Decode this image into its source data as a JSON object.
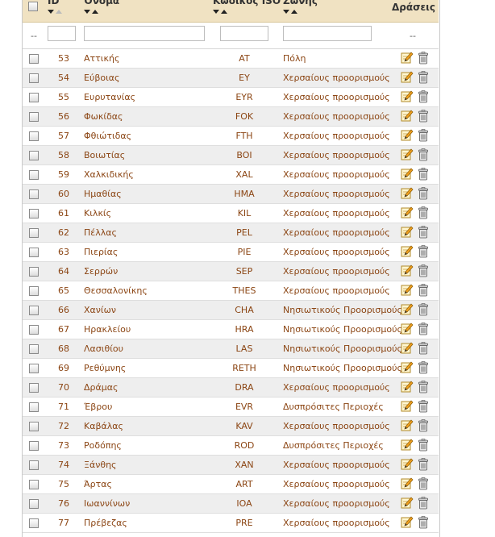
{
  "header": {
    "id_label": "ID",
    "name_label": "Όνομα",
    "iso_label": "Κωδικός ISO",
    "zone_label": "Ζώνης",
    "actions_label": "Δράσεις"
  },
  "filters": {
    "left_dash": "--",
    "right_dash": "--",
    "id_value": "",
    "name_value": "",
    "iso_value": "",
    "zone_value": ""
  },
  "rows": [
    {
      "id": "53",
      "name": "Αττικής",
      "iso": "AT",
      "zone": "Πόλη"
    },
    {
      "id": "54",
      "name": "Εύβοιας",
      "iso": "EY",
      "zone": "Χερσαίους προορισμούς"
    },
    {
      "id": "55",
      "name": "Ευρυτανίας",
      "iso": "EYR",
      "zone": "Χερσαίους προορισμούς"
    },
    {
      "id": "56",
      "name": "Φωκίδας",
      "iso": "FOK",
      "zone": "Χερσαίους προορισμούς"
    },
    {
      "id": "57",
      "name": "Φθιώτιδας",
      "iso": "FTH",
      "zone": "Χερσαίους προορισμούς"
    },
    {
      "id": "58",
      "name": "Βοιωτίας",
      "iso": "BOI",
      "zone": "Χερσαίους προορισμούς"
    },
    {
      "id": "59",
      "name": "Χαλκιδικής",
      "iso": "XAL",
      "zone": "Χερσαίους προορισμούς"
    },
    {
      "id": "60",
      "name": "Ημαθίας",
      "iso": "HMA",
      "zone": "Χερσαίους προορισμούς"
    },
    {
      "id": "61",
      "name": "Κιλκίς",
      "iso": "KIL",
      "zone": "Χερσαίους προορισμούς"
    },
    {
      "id": "62",
      "name": "Πέλλας",
      "iso": "PEL",
      "zone": "Χερσαίους προορισμούς"
    },
    {
      "id": "63",
      "name": "Πιερίας",
      "iso": "PIE",
      "zone": "Χερσαίους προορισμούς"
    },
    {
      "id": "64",
      "name": "Σερρών",
      "iso": "SEP",
      "zone": "Χερσαίους προορισμούς"
    },
    {
      "id": "65",
      "name": "Θεσσαλονίκης",
      "iso": "THES",
      "zone": "Χερσαίους προορισμούς"
    },
    {
      "id": "66",
      "name": "Χανίων",
      "iso": "CHA",
      "zone": "Νησιωτικούς Προορισμούς"
    },
    {
      "id": "67",
      "name": "Ηρακλείου",
      "iso": "HRA",
      "zone": "Νησιωτικούς Προορισμούς"
    },
    {
      "id": "68",
      "name": "Λασιθίου",
      "iso": "LAS",
      "zone": "Νησιωτικούς Προορισμούς"
    },
    {
      "id": "69",
      "name": "Ρεθύμνης",
      "iso": "RETH",
      "zone": "Νησιωτικούς Προορισμούς"
    },
    {
      "id": "70",
      "name": "Δράμας",
      "iso": "DRA",
      "zone": "Χερσαίους προορισμούς"
    },
    {
      "id": "71",
      "name": "Έβρου",
      "iso": "EVR",
      "zone": "Δυσπρόσιτες Περιοχές"
    },
    {
      "id": "72",
      "name": "Καβάλας",
      "iso": "KAV",
      "zone": "Χερσαίους προορισμούς"
    },
    {
      "id": "73",
      "name": "Ροδόπης",
      "iso": "ROD",
      "zone": "Δυσπρόσιτες Περιοχές"
    },
    {
      "id": "74",
      "name": "Ξάνθης",
      "iso": "XAN",
      "zone": "Χερσαίους προορισμούς"
    },
    {
      "id": "75",
      "name": "Άρτας",
      "iso": "ART",
      "zone": "Χερσαίους προορισμούς"
    },
    {
      "id": "76",
      "name": "Ιωαννίνων",
      "iso": "IOA",
      "zone": "Χερσαίους προορισμούς"
    },
    {
      "id": "77",
      "name": "Πρέβεζας",
      "iso": "PRE",
      "zone": "Χερσαίους προορισμούς"
    }
  ],
  "icons": {
    "edit": "pencil-edit-icon",
    "delete": "trash-can-icon"
  },
  "colors": {
    "link": "#8b4513",
    "header_bg": "#f0e2c2",
    "alt_row": "#eeeeee"
  }
}
